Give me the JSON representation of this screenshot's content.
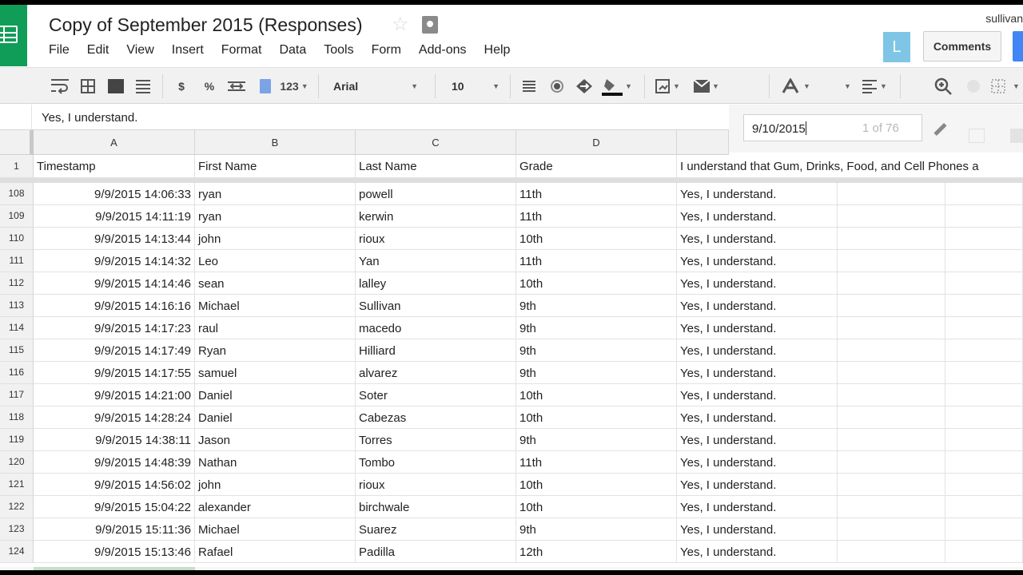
{
  "header": {
    "title": "Copy of September 2015 (Responses)",
    "user": "sullivan",
    "avatar_letter": "L",
    "comments_label": "Comments"
  },
  "menu": [
    "File",
    "Edit",
    "View",
    "Insert",
    "Format",
    "Data",
    "Tools",
    "Form",
    "Add-ons",
    "Help"
  ],
  "toolbar": {
    "currency": "$",
    "percent": "%",
    "number_format": "123",
    "font": "Arial",
    "font_size": "10",
    "icons": [
      "text-wrap-icon",
      "border-icon",
      "fill-icon",
      "align-icon",
      "decrease-decimal-icon",
      "color-icon",
      "merge-icon",
      "paint-bucket-icon",
      "insert-chart-icon",
      "email-icon",
      "text-color-icon",
      "horizontal-align-icon",
      "zoom-icon",
      "grid-icon"
    ]
  },
  "formula_bar": {
    "value": "Yes, I understand."
  },
  "find": {
    "query": "9/10/2015",
    "count": "1 of 76"
  },
  "grid": {
    "columns": [
      "A",
      "B",
      "C",
      "D"
    ],
    "header_row_number": "1",
    "header_cells": [
      "Timestamp",
      "First Name",
      "Last Name",
      "Grade",
      "I understand that Gum, Drinks, Food, and Cell Phones a"
    ],
    "rows": [
      {
        "n": "108",
        "ts": "9/9/2015 14:06:33",
        "first": "ryan",
        "last": "powell",
        "grade": "11th",
        "ack": "Yes, I understand."
      },
      {
        "n": "109",
        "ts": "9/9/2015 14:11:19",
        "first": "ryan",
        "last": "kerwin",
        "grade": "11th",
        "ack": "Yes, I understand."
      },
      {
        "n": "110",
        "ts": "9/9/2015 14:13:44",
        "first": "john",
        "last": "rioux",
        "grade": "10th",
        "ack": "Yes, I understand."
      },
      {
        "n": "111",
        "ts": "9/9/2015 14:14:32",
        "first": "Leo",
        "last": "Yan",
        "grade": "11th",
        "ack": "Yes, I understand."
      },
      {
        "n": "112",
        "ts": "9/9/2015 14:14:46",
        "first": "sean",
        "last": "lalley",
        "grade": "10th",
        "ack": "Yes, I understand."
      },
      {
        "n": "113",
        "ts": "9/9/2015 14:16:16",
        "first": "Michael",
        "last": "Sullivan",
        "grade": "9th",
        "ack": "Yes, I understand."
      },
      {
        "n": "114",
        "ts": "9/9/2015 14:17:23",
        "first": "raul",
        "last": "macedo",
        "grade": "9th",
        "ack": "Yes, I understand."
      },
      {
        "n": "115",
        "ts": "9/9/2015 14:17:49",
        "first": "Ryan",
        "last": "Hilliard",
        "grade": "9th",
        "ack": "Yes, I understand."
      },
      {
        "n": "116",
        "ts": "9/9/2015 14:17:55",
        "first": "samuel",
        "last": "alvarez",
        "grade": "9th",
        "ack": "Yes, I understand."
      },
      {
        "n": "117",
        "ts": "9/9/2015 14:21:00",
        "first": "Daniel",
        "last": "Soter",
        "grade": "10th",
        "ack": "Yes, I understand."
      },
      {
        "n": "118",
        "ts": "9/9/2015 14:28:24",
        "first": "Daniel",
        "last": "Cabezas",
        "grade": "10th",
        "ack": "Yes, I understand."
      },
      {
        "n": "119",
        "ts": "9/9/2015 14:38:11",
        "first": "Jason",
        "last": "Torres",
        "grade": "9th",
        "ack": "Yes, I understand."
      },
      {
        "n": "120",
        "ts": "9/9/2015 14:48:39",
        "first": "Nathan",
        "last": "Tombo",
        "grade": "11th",
        "ack": "Yes, I understand."
      },
      {
        "n": "121",
        "ts": "9/9/2015 14:56:02",
        "first": "john",
        "last": "rioux",
        "grade": "10th",
        "ack": "Yes, I understand."
      },
      {
        "n": "122",
        "ts": "9/9/2015 15:04:22",
        "first": "alexander",
        "last": "birchwale",
        "grade": "10th",
        "ack": "Yes, I understand."
      },
      {
        "n": "123",
        "ts": "9/9/2015 15:11:36",
        "first": "Michael",
        "last": "Suarez",
        "grade": "9th",
        "ack": "Yes, I understand."
      },
      {
        "n": "124",
        "ts": "9/9/2015 15:13:46",
        "first": "Rafael",
        "last": "Padilla",
        "grade": "12th",
        "ack": "Yes, I understand."
      }
    ]
  },
  "colors": {
    "brand": "#0f9d58",
    "share": "#4285f4",
    "avatar": "#7fc6e6"
  }
}
